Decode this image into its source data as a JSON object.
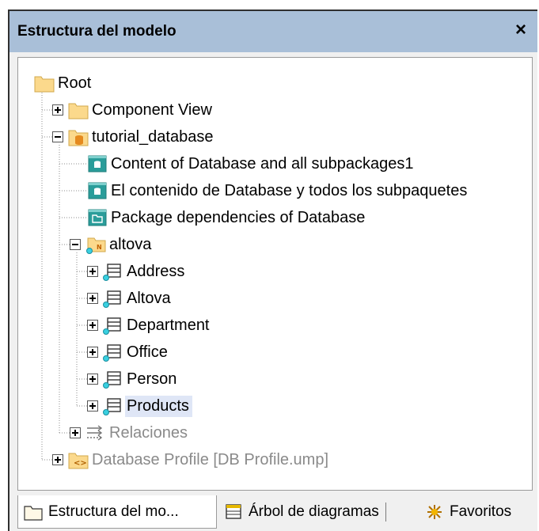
{
  "panel": {
    "title": "Estructura del modelo",
    "close_label": "×"
  },
  "tree": {
    "root": "Root",
    "component_view": "Component View",
    "tutorial_database": "tutorial_database",
    "diagram_content_1": "Content of Database and all subpackages1",
    "diagram_content_2": "El contenido de Database y todos los subpaquetes",
    "diagram_dependencies": "Package dependencies of Database",
    "altova": "altova",
    "tables": [
      "Address",
      "Altova",
      "Department",
      "Office",
      "Person",
      "Products"
    ],
    "selected_table": "Products",
    "relations": "Relaciones",
    "database_profile": "Database Profile [DB Profile.ump]"
  },
  "tabs": [
    {
      "label": "Estructura del mo...",
      "icon": "folder-icon",
      "active": true
    },
    {
      "label": "Árbol de diagramas",
      "icon": "diagram-tree-icon",
      "active": false
    },
    {
      "label": "Favoritos",
      "icon": "favorites-icon",
      "active": false
    }
  ],
  "colors": {
    "titlebar": "#a9bfd8",
    "folder": "#fbd98c",
    "diagram_teal": "#2a9d9a",
    "selection": "#dfe6f6"
  }
}
